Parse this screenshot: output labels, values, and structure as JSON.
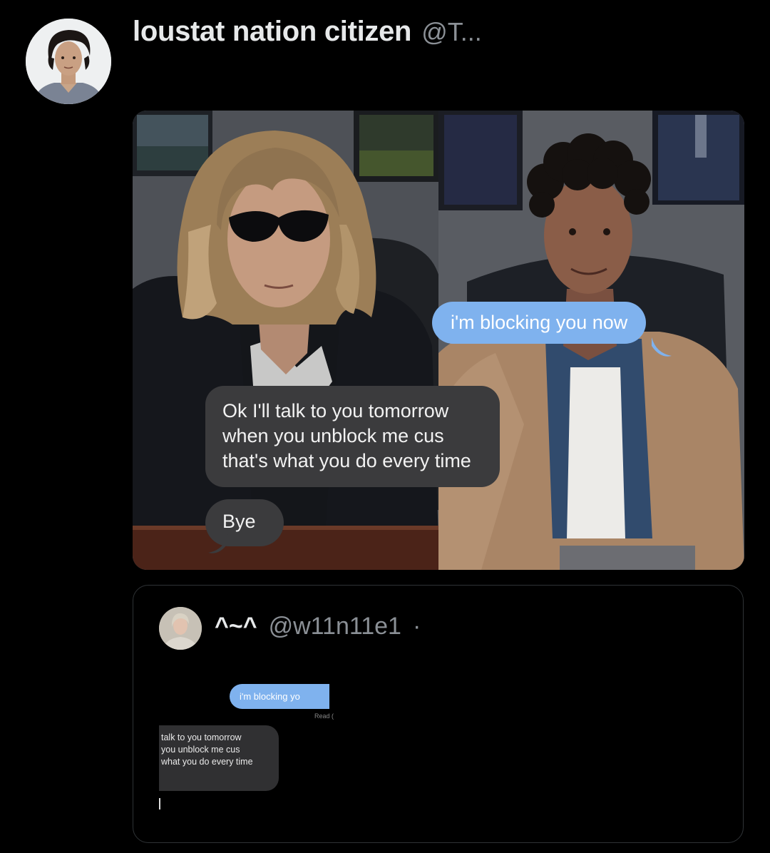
{
  "tweet": {
    "author": {
      "display_name": "loustat nation citizen",
      "handle": "@T...",
      "avatar_icon": "profile-photo"
    },
    "media": {
      "left_panel": {
        "message_grey": {
          "lines": [
            "Ok I'll talk to you tomorrow",
            "when you unblock me cus",
            "that's what you do every time"
          ]
        },
        "message_bye": "Bye"
      },
      "right_panel": {
        "message_blue": "i'm blocking you now"
      }
    },
    "quoted": {
      "display_name": "^~^",
      "handle": "@w11n11e1",
      "separator": "·",
      "avatar_icon": "profile-photo",
      "screenshot": {
        "blue_message": "i'm blocking yo",
        "read_label": "Read (",
        "grey_lines": [
          "talk to you tomorrow",
          "you unblock me cus",
          "what you do every time"
        ]
      }
    }
  },
  "colors": {
    "background": "#000000",
    "text_primary": "#e7e9ea",
    "text_secondary": "#8b9096",
    "imessage_blue": "#7fb2ee",
    "imessage_grey": "#3b3b3d",
    "border": "#2f3336"
  }
}
